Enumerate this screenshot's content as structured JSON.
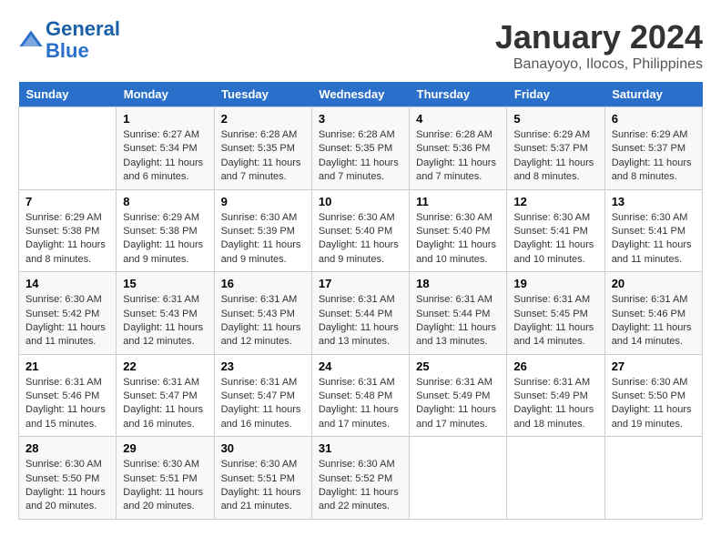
{
  "logo": {
    "line1": "General",
    "line2": "Blue"
  },
  "title": "January 2024",
  "subtitle": "Banayoyo, Ilocos, Philippines",
  "headers": [
    "Sunday",
    "Monday",
    "Tuesday",
    "Wednesday",
    "Thursday",
    "Friday",
    "Saturday"
  ],
  "weeks": [
    [
      {
        "day": "",
        "info": ""
      },
      {
        "day": "1",
        "info": "Sunrise: 6:27 AM\nSunset: 5:34 PM\nDaylight: 11 hours\nand 6 minutes."
      },
      {
        "day": "2",
        "info": "Sunrise: 6:28 AM\nSunset: 5:35 PM\nDaylight: 11 hours\nand 7 minutes."
      },
      {
        "day": "3",
        "info": "Sunrise: 6:28 AM\nSunset: 5:35 PM\nDaylight: 11 hours\nand 7 minutes."
      },
      {
        "day": "4",
        "info": "Sunrise: 6:28 AM\nSunset: 5:36 PM\nDaylight: 11 hours\nand 7 minutes."
      },
      {
        "day": "5",
        "info": "Sunrise: 6:29 AM\nSunset: 5:37 PM\nDaylight: 11 hours\nand 8 minutes."
      },
      {
        "day": "6",
        "info": "Sunrise: 6:29 AM\nSunset: 5:37 PM\nDaylight: 11 hours\nand 8 minutes."
      }
    ],
    [
      {
        "day": "7",
        "info": "Sunrise: 6:29 AM\nSunset: 5:38 PM\nDaylight: 11 hours\nand 8 minutes."
      },
      {
        "day": "8",
        "info": "Sunrise: 6:29 AM\nSunset: 5:38 PM\nDaylight: 11 hours\nand 9 minutes."
      },
      {
        "day": "9",
        "info": "Sunrise: 6:30 AM\nSunset: 5:39 PM\nDaylight: 11 hours\nand 9 minutes."
      },
      {
        "day": "10",
        "info": "Sunrise: 6:30 AM\nSunset: 5:40 PM\nDaylight: 11 hours\nand 9 minutes."
      },
      {
        "day": "11",
        "info": "Sunrise: 6:30 AM\nSunset: 5:40 PM\nDaylight: 11 hours\nand 10 minutes."
      },
      {
        "day": "12",
        "info": "Sunrise: 6:30 AM\nSunset: 5:41 PM\nDaylight: 11 hours\nand 10 minutes."
      },
      {
        "day": "13",
        "info": "Sunrise: 6:30 AM\nSunset: 5:41 PM\nDaylight: 11 hours\nand 11 minutes."
      }
    ],
    [
      {
        "day": "14",
        "info": "Sunrise: 6:30 AM\nSunset: 5:42 PM\nDaylight: 11 hours\nand 11 minutes."
      },
      {
        "day": "15",
        "info": "Sunrise: 6:31 AM\nSunset: 5:43 PM\nDaylight: 11 hours\nand 12 minutes."
      },
      {
        "day": "16",
        "info": "Sunrise: 6:31 AM\nSunset: 5:43 PM\nDaylight: 11 hours\nand 12 minutes."
      },
      {
        "day": "17",
        "info": "Sunrise: 6:31 AM\nSunset: 5:44 PM\nDaylight: 11 hours\nand 13 minutes."
      },
      {
        "day": "18",
        "info": "Sunrise: 6:31 AM\nSunset: 5:44 PM\nDaylight: 11 hours\nand 13 minutes."
      },
      {
        "day": "19",
        "info": "Sunrise: 6:31 AM\nSunset: 5:45 PM\nDaylight: 11 hours\nand 14 minutes."
      },
      {
        "day": "20",
        "info": "Sunrise: 6:31 AM\nSunset: 5:46 PM\nDaylight: 11 hours\nand 14 minutes."
      }
    ],
    [
      {
        "day": "21",
        "info": "Sunrise: 6:31 AM\nSunset: 5:46 PM\nDaylight: 11 hours\nand 15 minutes."
      },
      {
        "day": "22",
        "info": "Sunrise: 6:31 AM\nSunset: 5:47 PM\nDaylight: 11 hours\nand 16 minutes."
      },
      {
        "day": "23",
        "info": "Sunrise: 6:31 AM\nSunset: 5:47 PM\nDaylight: 11 hours\nand 16 minutes."
      },
      {
        "day": "24",
        "info": "Sunrise: 6:31 AM\nSunset: 5:48 PM\nDaylight: 11 hours\nand 17 minutes."
      },
      {
        "day": "25",
        "info": "Sunrise: 6:31 AM\nSunset: 5:49 PM\nDaylight: 11 hours\nand 17 minutes."
      },
      {
        "day": "26",
        "info": "Sunrise: 6:31 AM\nSunset: 5:49 PM\nDaylight: 11 hours\nand 18 minutes."
      },
      {
        "day": "27",
        "info": "Sunrise: 6:30 AM\nSunset: 5:50 PM\nDaylight: 11 hours\nand 19 minutes."
      }
    ],
    [
      {
        "day": "28",
        "info": "Sunrise: 6:30 AM\nSunset: 5:50 PM\nDaylight: 11 hours\nand 20 minutes."
      },
      {
        "day": "29",
        "info": "Sunrise: 6:30 AM\nSunset: 5:51 PM\nDaylight: 11 hours\nand 20 minutes."
      },
      {
        "day": "30",
        "info": "Sunrise: 6:30 AM\nSunset: 5:51 PM\nDaylight: 11 hours\nand 21 minutes."
      },
      {
        "day": "31",
        "info": "Sunrise: 6:30 AM\nSunset: 5:52 PM\nDaylight: 11 hours\nand 22 minutes."
      },
      {
        "day": "",
        "info": ""
      },
      {
        "day": "",
        "info": ""
      },
      {
        "day": "",
        "info": ""
      }
    ]
  ]
}
